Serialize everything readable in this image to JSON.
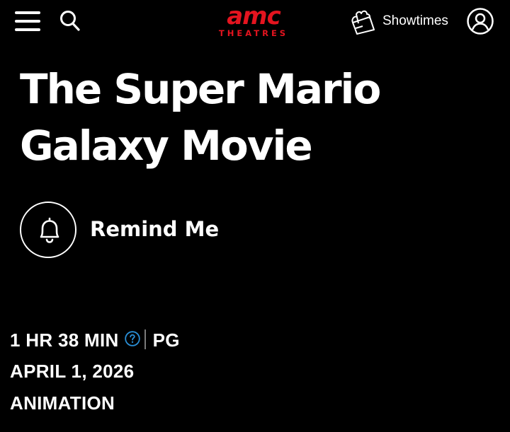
{
  "header": {
    "menu_icon": "hamburger-menu-icon",
    "search_icon": "search-icon",
    "logo": {
      "wordmark": "amc",
      "subtitle": "THEATRES",
      "color": "#e4141f"
    },
    "showtimes": {
      "icon": "ticket-popcorn-icon",
      "label": "Showtimes"
    },
    "account_icon": "user-account-icon"
  },
  "movie": {
    "title": "The Super Mario Galaxy Movie",
    "remind": {
      "icon": "bell-icon",
      "label": "Remind Me"
    },
    "runtime": "1 HR 38 MIN",
    "help_icon": "question-circle-icon",
    "rating": "PG",
    "release_date": "APRIL 1, 2026",
    "genre": "ANIMATION"
  },
  "colors": {
    "background": "#000000",
    "text": "#ffffff",
    "brand_red": "#e4141f",
    "help_blue": "#2a8fd6",
    "separator": "#7a7a7a"
  }
}
